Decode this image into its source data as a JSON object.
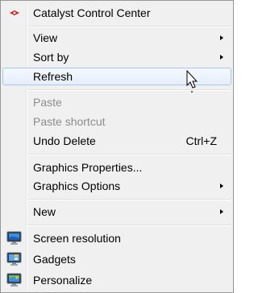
{
  "menu": {
    "catalyst": "Catalyst Control Center",
    "view": "View",
    "sort_by": "Sort by",
    "refresh": "Refresh",
    "paste": "Paste",
    "paste_shortcut": "Paste shortcut",
    "undo_delete": "Undo Delete",
    "undo_delete_shortcut": "Ctrl+Z",
    "graphics_properties": "Graphics Properties...",
    "graphics_options": "Graphics Options",
    "new": "New",
    "screen_resolution": "Screen resolution",
    "gadgets": "Gadgets",
    "personalize": "Personalize"
  },
  "icons": {
    "catalyst": "ati-catalyst-icon",
    "screen_resolution": "monitor-icon",
    "gadgets": "gadgets-icon",
    "personalize": "personalize-icon",
    "cursor": "mouse-pointer-icon"
  },
  "colors": {
    "menu_bg": "#f0f0f0",
    "hover_border": "#a8c5ea",
    "disabled_text": "#8d8d8d"
  }
}
